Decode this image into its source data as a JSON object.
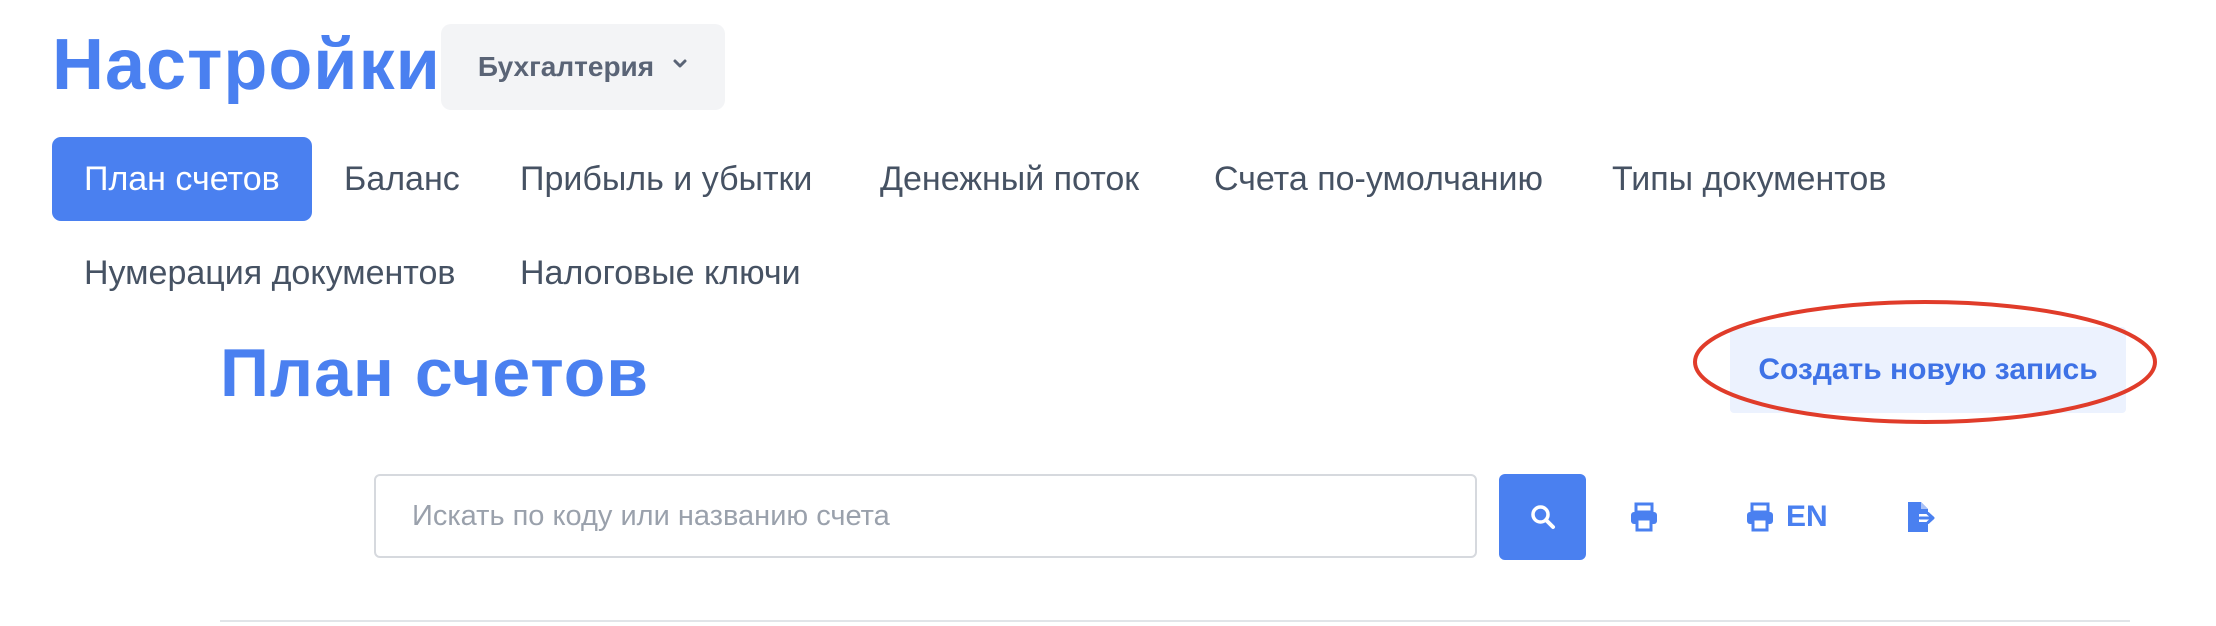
{
  "header": {
    "title": "Настройки",
    "module_select": {
      "selected": "Бухгалтерия",
      "icon": "chevron-down-icon"
    }
  },
  "tabs": [
    {
      "label": "План счетов",
      "active": true
    },
    {
      "label": "Баланс",
      "active": false
    },
    {
      "label": "Прибыль и убытки",
      "active": false
    },
    {
      "label": "Денежный поток",
      "active": false
    },
    {
      "label": "Счета по-умолчанию",
      "active": false
    },
    {
      "label": "Типы документов",
      "active": false
    },
    {
      "label": "Нумерация документов",
      "active": false
    },
    {
      "label": "Налоговые ключи",
      "active": false
    }
  ],
  "section": {
    "title": "План счетов",
    "create_button": "Создать новую запись"
  },
  "search": {
    "placeholder": "Искать по коду или названию счета",
    "value": "",
    "button_icon": "search-icon"
  },
  "actions": {
    "print_icon": "print-icon",
    "print_en_label": "EN",
    "export_icon": "file-export-icon"
  },
  "colors": {
    "accent": "#4a80f0",
    "highlight": "#e03c2a",
    "button_light": "#ecf2fe"
  }
}
